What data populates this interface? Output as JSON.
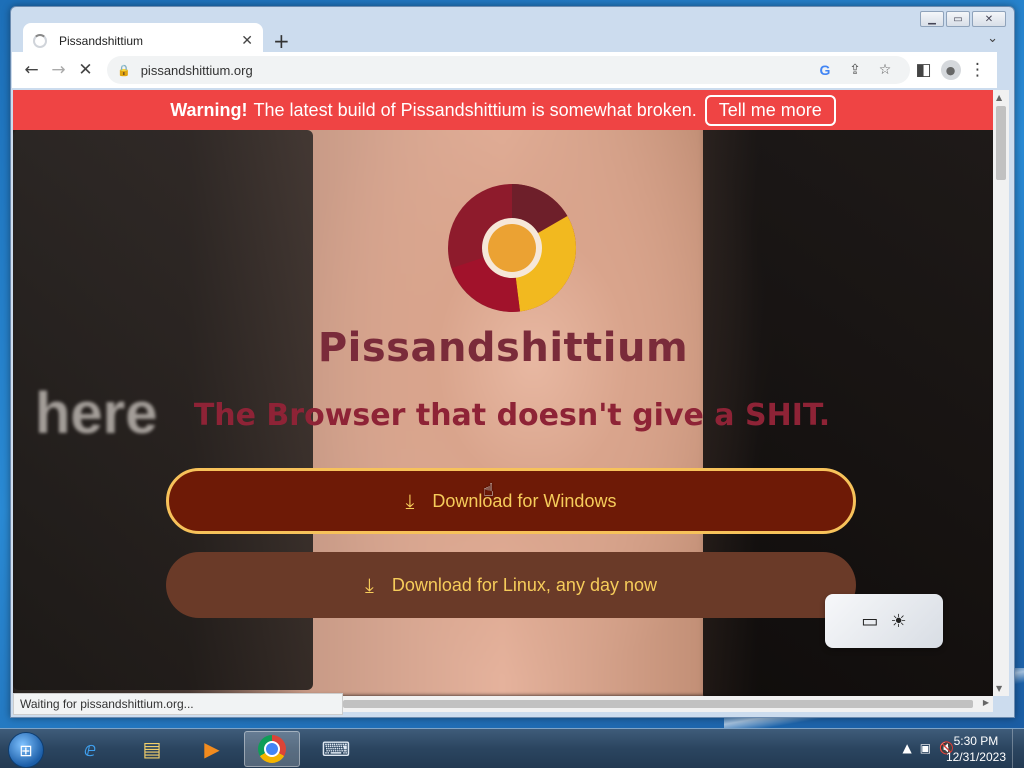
{
  "browser": {
    "tab_title": "Pissandshittium",
    "url": "pissandshittium.org",
    "status_text": "Waiting for pissandshittium.org..."
  },
  "page": {
    "warning_label": "Warning!",
    "warning_text": "The latest build of Pissandshittium is somewhat broken.",
    "warning_button": "Tell me more",
    "brand_name": "Pissandshittium",
    "tagline": "The Browser that doesn't give a SHIT.",
    "download_windows": "Download for Windows",
    "download_linux": "Download for Linux, any day now",
    "background_text": "here"
  },
  "taskbar": {
    "time": "5:30 PM",
    "date": "12/31/2023",
    "apps": [
      "internet-explorer",
      "windows-explorer",
      "media-player",
      "chrome",
      "on-screen-keyboard"
    ]
  },
  "colors": {
    "warning_bar": "#ef4444",
    "download_windows_bg": "#6e1a06",
    "download_linux_bg": "#6a3a28",
    "download_text": "#f6cc5a",
    "brand": "#7a2b3a"
  }
}
